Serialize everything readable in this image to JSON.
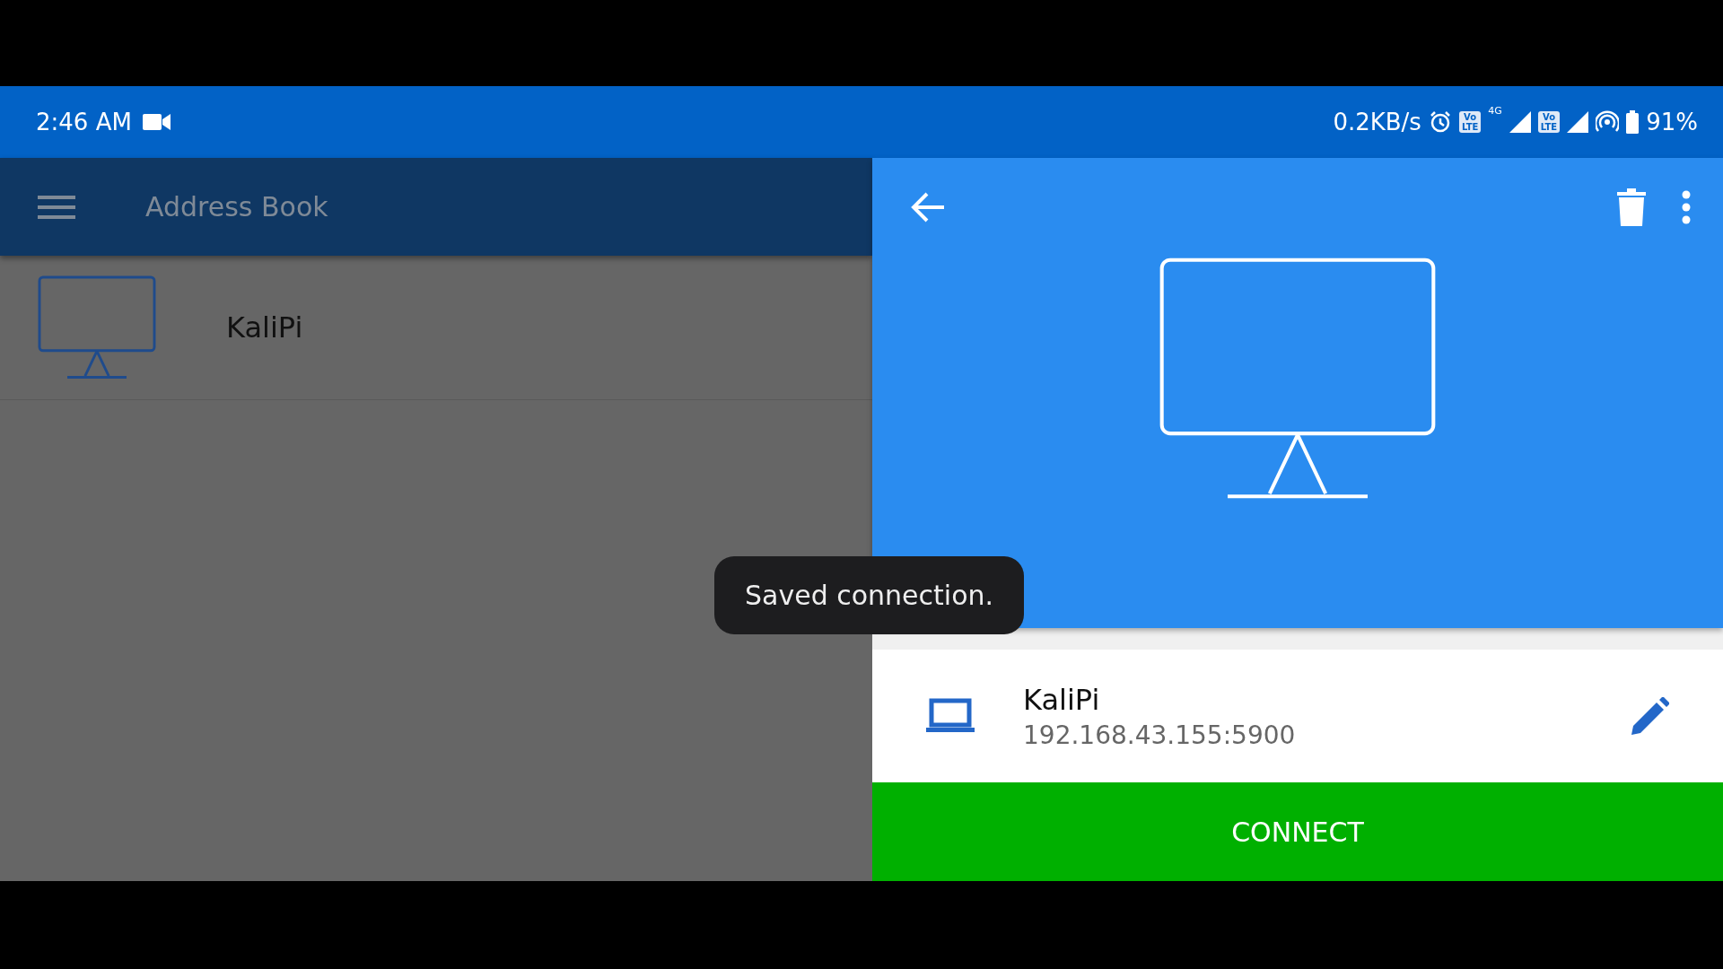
{
  "status_bar": {
    "time": "2:46 AM",
    "speed": "0.2KB/s",
    "network_type": "4G",
    "volte_badges": [
      {
        "top": "Vo",
        "bottom": "LTE"
      },
      {
        "top": "Vo",
        "bottom": "LTE"
      }
    ],
    "battery": "91%"
  },
  "address_book": {
    "title": "Address Book",
    "items": [
      {
        "name": "KaliPi"
      }
    ]
  },
  "detail": {
    "connection": {
      "name": "KaliPi",
      "address": "192.168.43.155:5900"
    },
    "connect_button": "CONNECT"
  },
  "toast": "Saved connection."
}
